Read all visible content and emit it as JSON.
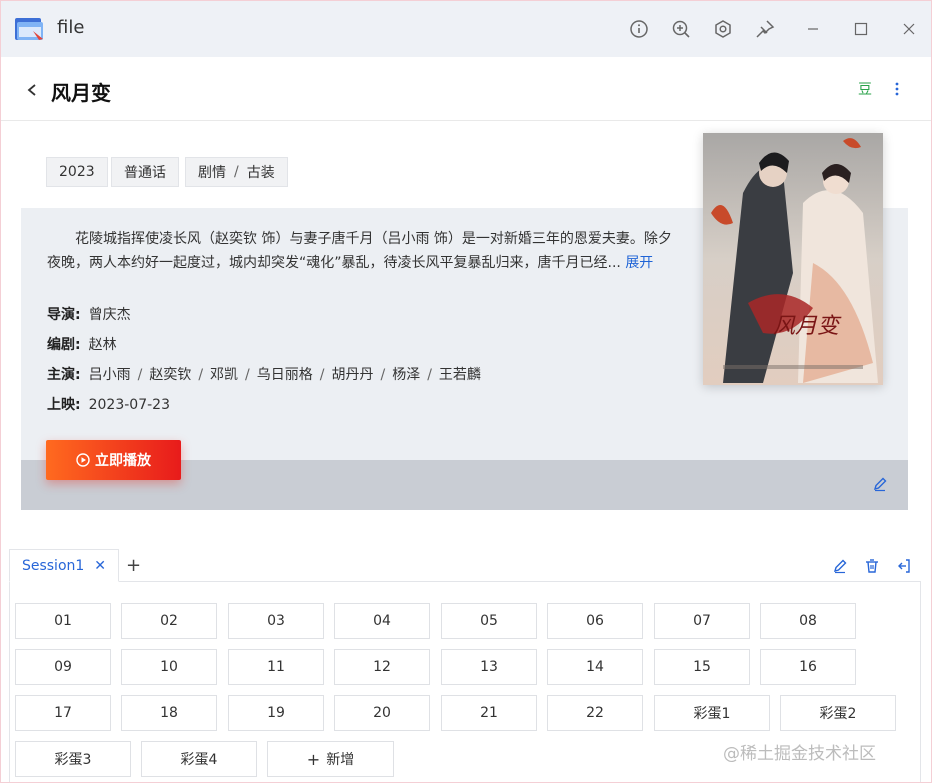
{
  "window": {
    "title": "file"
  },
  "header": {
    "title": "风月变",
    "douban_label": "豆"
  },
  "tags": {
    "year": "2023",
    "language": "普通话",
    "genre_1": "剧情",
    "genre_sep": "/",
    "genre_2": "古装"
  },
  "synopsis": {
    "text": "花陵城指挥使凌长风（赵奕钦 饰）与妻子唐千月（吕小雨 饰）是一对新婚三年的恩爱夫妻。除夕夜晚，两人本约好一起度过，城内却突发“魂化”暴乱，待凌长风平复暴乱归来，唐千月已经...",
    "expand_label": "展开"
  },
  "info": {
    "director_label": "导演:",
    "director": "曾庆杰",
    "writer_label": "编剧:",
    "writer": "赵林",
    "cast_label": "主演:",
    "cast": [
      "吕小雨",
      "赵奕钦",
      "邓凯",
      "乌日丽格",
      "胡丹丹",
      "杨泽",
      "王若麟"
    ],
    "cast_sep": "/",
    "release_label": "上映:",
    "release": "2023-07-23"
  },
  "play_button": {
    "label": "立即播放"
  },
  "tabs": {
    "active_label": "Session1",
    "close_glyph": "✕",
    "add_glyph": "+"
  },
  "episodes": [
    "01",
    "02",
    "03",
    "04",
    "05",
    "06",
    "07",
    "08",
    "09",
    "10",
    "11",
    "12",
    "13",
    "14",
    "15",
    "16",
    "17",
    "18",
    "19",
    "20",
    "21",
    "22",
    "彩蛋1",
    "彩蛋2",
    "彩蛋3",
    "彩蛋4"
  ],
  "add_episode_label": "新增",
  "watermark": "@稀土掘金技术社区",
  "colors": {
    "accent": "#2866d8",
    "play_start": "#ff6a1f",
    "play_end": "#e81b1b",
    "douban": "#2aa34a"
  }
}
